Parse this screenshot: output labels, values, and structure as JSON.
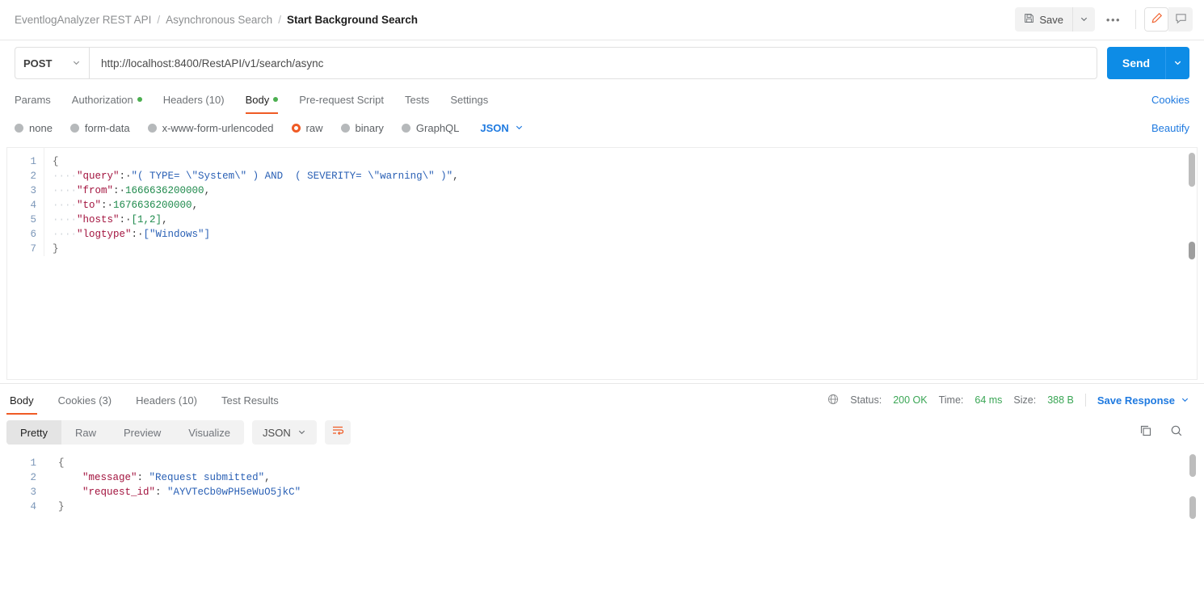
{
  "breadcrumb": {
    "items": [
      "EventlogAnalyzer REST API",
      "Asynchronous Search",
      "Start Background Search"
    ],
    "separator": "/"
  },
  "toolbar": {
    "save_label": "Save",
    "save_icon": "floppy-disk-icon",
    "save_caret_icon": "chevron-down-icon",
    "more_label": "•••",
    "edit_icon": "pencil-icon",
    "comment_icon": "comment-icon",
    "accent_color": "#ef5b25"
  },
  "request": {
    "method": "POST",
    "method_caret_icon": "chevron-down-icon",
    "url": "http://localhost:8400/RestAPI/v1/search/async",
    "url_placeholder": "Enter request URL",
    "send_label": "Send",
    "send_caret_icon": "chevron-down-icon",
    "send_color": "#0d8ce6"
  },
  "request_tabs": [
    {
      "label": "Params",
      "dot": false,
      "active": false
    },
    {
      "label": "Authorization",
      "dot": true,
      "active": false
    },
    {
      "label": "Headers (10)",
      "dot": false,
      "active": false
    },
    {
      "label": "Body",
      "dot": true,
      "active": true
    },
    {
      "label": "Pre-request Script",
      "dot": false,
      "active": false
    },
    {
      "label": "Tests",
      "dot": false,
      "active": false
    },
    {
      "label": "Settings",
      "dot": false,
      "active": false
    }
  ],
  "cookies_link": "Cookies",
  "beautify_link": "Beautify",
  "body_types": [
    {
      "label": "none",
      "selected": false
    },
    {
      "label": "form-data",
      "selected": false
    },
    {
      "label": "x-www-form-urlencoded",
      "selected": false
    },
    {
      "label": "raw",
      "selected": true
    },
    {
      "label": "binary",
      "selected": false
    },
    {
      "label": "GraphQL",
      "selected": false
    }
  ],
  "body_format": "JSON",
  "body_format_caret_icon": "chevron-down-icon",
  "request_body": {
    "line_numbers": [
      "1",
      "2",
      "3",
      "4",
      "5",
      "6",
      "7"
    ],
    "lines": [
      {
        "n": "1",
        "text": "{"
      },
      {
        "n": "2",
        "key": "\"query\"",
        "value": "\"( TYPE= \\\"System\\\" ) AND  ( SEVERITY= \\\"warning\\\" )\"",
        "trail": ","
      },
      {
        "n": "3",
        "key": "\"from\"",
        "value": "1666636200000",
        "trail": ",",
        "numeric": true
      },
      {
        "n": "4",
        "key": "\"to\"",
        "value": "1676636200000",
        "trail": ",",
        "numeric": true
      },
      {
        "n": "5",
        "key": "\"hosts\"",
        "value": "[1,2]",
        "trail": ",",
        "numeric": true
      },
      {
        "n": "6",
        "key": "\"logtype\"",
        "value": "[\"Windows\"]",
        "trail": ""
      },
      {
        "n": "7",
        "text": "}"
      }
    ]
  },
  "response_tabs": [
    {
      "label": "Body",
      "active": true
    },
    {
      "label": "Cookies (3)",
      "active": false
    },
    {
      "label": "Headers (10)",
      "active": false
    },
    {
      "label": "Test Results",
      "active": false
    }
  ],
  "response_meta": {
    "globe_icon": "globe-icon",
    "status_label": "Status:",
    "status_value": "200 OK",
    "time_label": "Time:",
    "time_value": "64 ms",
    "size_label": "Size:",
    "size_value": "388 B",
    "save_response_label": "Save Response",
    "save_response_caret_icon": "chevron-down-icon",
    "value_color": "#3aa655"
  },
  "response_views": [
    {
      "label": "Pretty",
      "active": true
    },
    {
      "label": "Raw",
      "active": false
    },
    {
      "label": "Preview",
      "active": false
    },
    {
      "label": "Visualize",
      "active": false
    }
  ],
  "response_format": "JSON",
  "response_format_caret_icon": "chevron-down-icon",
  "wrap_icon": "word-wrap-icon",
  "copy_icon": "copy-icon",
  "search_icon": "search-icon",
  "response_body": {
    "line_numbers": [
      "1",
      "2",
      "3",
      "4"
    ],
    "lines": [
      {
        "n": "1",
        "text": "{"
      },
      {
        "n": "2",
        "key": "\"message\"",
        "value": "\"Request submitted\"",
        "trail": ","
      },
      {
        "n": "3",
        "key": "\"request_id\"",
        "value": "\"AYVTeCb0wPH5eWuO5jkC\"",
        "trail": ""
      },
      {
        "n": "4",
        "text": "}"
      }
    ]
  }
}
